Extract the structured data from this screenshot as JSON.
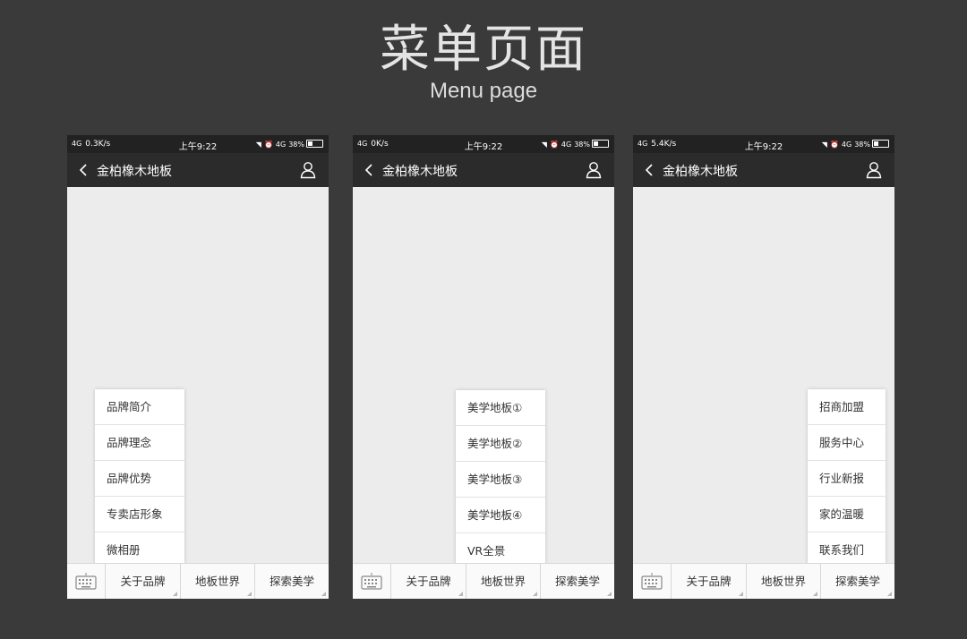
{
  "page_title_zh": "菜单页面",
  "page_title_en": "Menu page",
  "phones": [
    {
      "status": {
        "signal": "4G",
        "speed": "0.3K/s",
        "time": "上午9:22",
        "network": "4G",
        "battery": "38%"
      },
      "nav_title": "金柏橡木地板",
      "tabs": [
        "关于品牌",
        "地板世界",
        "探索美学"
      ],
      "menu": [
        "品牌简介",
        "品牌理念",
        "品牌优势",
        "专卖店形象",
        "微相册"
      ]
    },
    {
      "status": {
        "signal": "4G",
        "speed": "0K/s",
        "time": "上午9:22",
        "network": "4G",
        "battery": "38%"
      },
      "nav_title": "金柏橡木地板",
      "tabs": [
        "关于品牌",
        "地板世界",
        "探索美学"
      ],
      "menu": [
        "美学地板①",
        "美学地板②",
        "美学地板③",
        "美学地板④",
        "VR全景"
      ]
    },
    {
      "status": {
        "signal": "4G",
        "speed": "5.4K/s",
        "time": "上午9:22",
        "network": "4G",
        "battery": "38%"
      },
      "nav_title": "金柏橡木地板",
      "tabs": [
        "关于品牌",
        "地板世界",
        "探索美学"
      ],
      "menu": [
        "招商加盟",
        "服务中心",
        "行业新报",
        "家的温暖",
        "联系我们"
      ]
    }
  ]
}
